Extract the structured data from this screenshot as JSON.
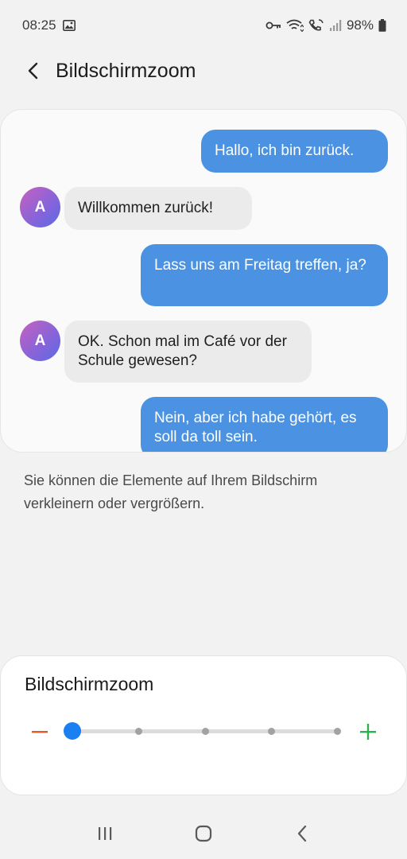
{
  "status_bar": {
    "time": "08:25",
    "battery": "98%",
    "icons": [
      "image-icon",
      "vpn-key-icon",
      "wifi-icon",
      "volte-call-icon",
      "signal-icon",
      "battery-icon"
    ]
  },
  "top_bar": {
    "back_icon": "back-arrow-icon",
    "title": "Bildschirmzoom"
  },
  "preview": {
    "avatar_letter": "A",
    "messages": [
      {
        "from": "me",
        "text": "Hallo, ich bin zurück."
      },
      {
        "from": "other",
        "text": "Willkommen zurück!"
      },
      {
        "from": "me",
        "text": "Lass uns am Freitag treffen, ja?"
      },
      {
        "from": "other",
        "text": "OK. Schon mal im Café vor der Schule gewesen?"
      },
      {
        "from": "me",
        "text": "Nein, aber ich habe gehört, es soll da toll sein."
      }
    ]
  },
  "description": "Sie können die Elemente auf Ihrem Bildschirm verkleinern oder vergrößern.",
  "zoom": {
    "title": "Bildschirmzoom",
    "steps": 5,
    "selected_step": 1,
    "minus_color": "#e8572a",
    "plus_color": "#2bb24c",
    "accent": "#1a7ff0"
  },
  "nav_bar": {
    "items": [
      "recent-apps-icon",
      "home-icon",
      "back-icon"
    ]
  }
}
